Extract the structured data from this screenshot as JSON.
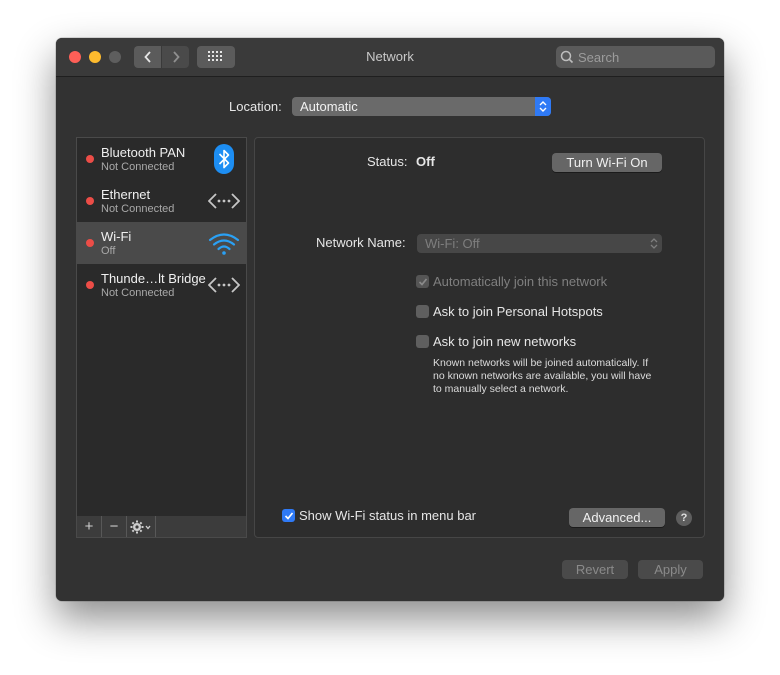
{
  "window": {
    "title": "Network"
  },
  "search": {
    "placeholder": "Search"
  },
  "location": {
    "label": "Location:",
    "value": "Automatic"
  },
  "services": [
    {
      "name": "Bluetooth PAN",
      "status": "Not Connected",
      "icon": "bluetooth-icon",
      "status_color": "#ec4d47"
    },
    {
      "name": "Ethernet",
      "status": "Not Connected",
      "icon": "ethernet-arrows-icon",
      "status_color": "#ec4d47"
    },
    {
      "name": "Wi-Fi",
      "status": "Off",
      "icon": "wifi-icon",
      "status_color": "#ec4d47",
      "selected": true
    },
    {
      "name": "Thunde…lt Bridge",
      "status": "Not Connected",
      "icon": "thunderbolt-arrows-icon",
      "status_color": "#ec4d47"
    }
  ],
  "toolbar": {
    "add": "+",
    "remove": "−"
  },
  "detail": {
    "status_label": "Status:",
    "status_value": "Off",
    "toggle_button": "Turn Wi-Fi On",
    "network_name_label": "Network Name:",
    "network_name_value": "Wi-Fi: Off",
    "auto_join": "Automatically join this network",
    "ask_hotspots": "Ask to join Personal Hotspots",
    "ask_new": "Ask to join new networks",
    "help_text_1": "Known networks will be joined automatically. If",
    "help_text_2": "no known networks are available, you will have",
    "help_text_3": "to manually select a network.",
    "show_status": "Show Wi-Fi status in menu bar",
    "advanced_button": "Advanced...",
    "help_button": "?"
  },
  "footer": {
    "revert": "Revert",
    "apply": "Apply"
  },
  "colors": {
    "accent": "#2f7af6",
    "status_red": "#ec4d47",
    "window_bg": "#323232"
  }
}
